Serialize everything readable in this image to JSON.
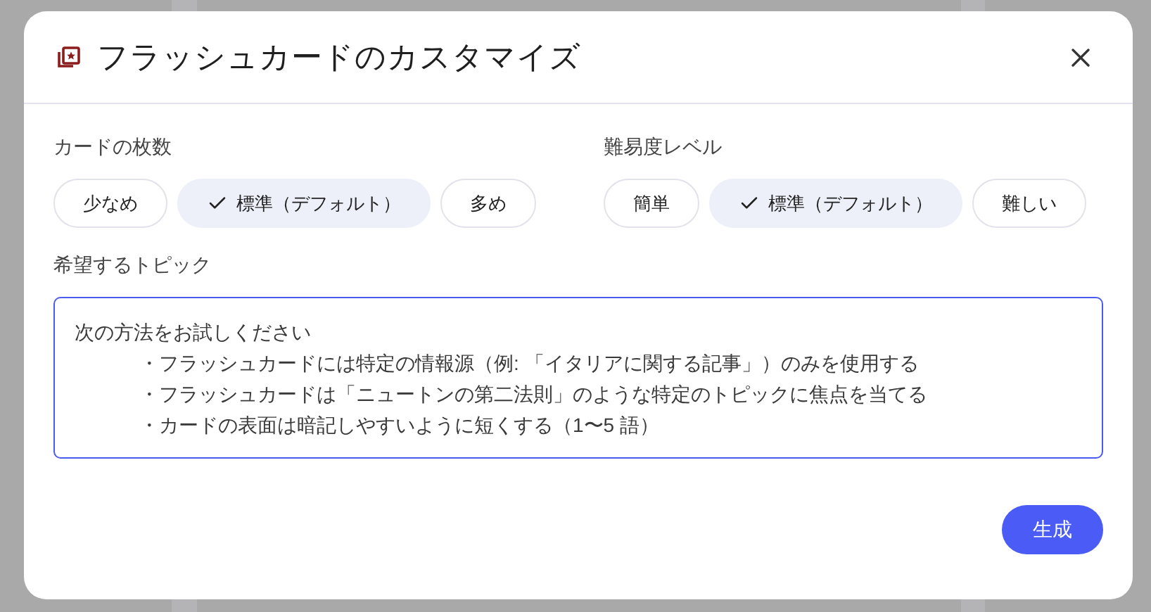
{
  "dialog": {
    "title": "フラッシュカードのカスタマイズ"
  },
  "settings": [
    {
      "label": "カードの枚数",
      "options": [
        {
          "label": "少なめ",
          "selected": false
        },
        {
          "label": "標準（デフォルト）",
          "selected": true
        },
        {
          "label": "多め",
          "selected": false
        }
      ]
    },
    {
      "label": "難易度レベル",
      "options": [
        {
          "label": "簡単",
          "selected": false
        },
        {
          "label": "標準（デフォルト）",
          "selected": true
        },
        {
          "label": "難しい",
          "selected": false
        }
      ]
    }
  ],
  "topics": {
    "label": "希望するトピック",
    "value": {
      "intro": "次の方法をお試しください",
      "bullets": [
        "・フラッシュカードには特定の情報源（例: 「イタリアに関する記事」）のみを使用する",
        "・フラッシュカードは「ニュートンの第二法則」のような特定のトピックに焦点を当てる",
        "・カードの表面は暗記しやすいように短くする（1〜5 語）"
      ]
    }
  },
  "buttons": [
    {
      "label": "生成"
    }
  ]
}
